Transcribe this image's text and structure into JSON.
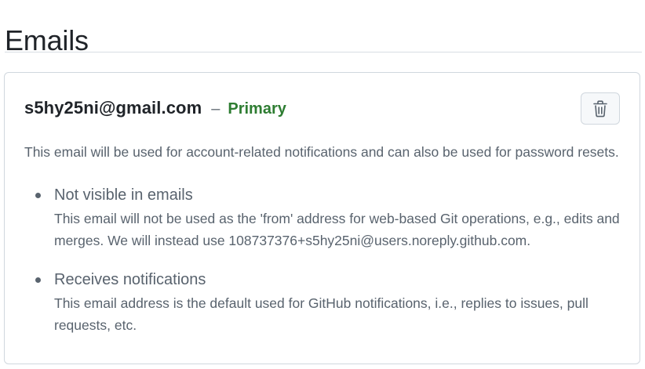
{
  "page": {
    "title": "Emails"
  },
  "email": {
    "address": "s5hy25ni@gmail.com",
    "separator": "–",
    "badge": "Primary",
    "description": "This email will be used for account-related notifications and can also be used for password resets.",
    "delete_icon": "trash-icon"
  },
  "properties": [
    {
      "title": "Not visible in emails",
      "description": "This email will not be used as the 'from' address for web-based Git operations, e.g., edits and merges. We will instead use 108737376+s5hy25ni@users.noreply.github.com."
    },
    {
      "title": "Receives notifications",
      "description": "This email address is the default used for GitHub notifications, i.e., replies to issues, pull requests, etc."
    }
  ],
  "colors": {
    "primary_badge": "#2e7d32",
    "muted_text": "#59636e",
    "border": "#d0d7de"
  }
}
